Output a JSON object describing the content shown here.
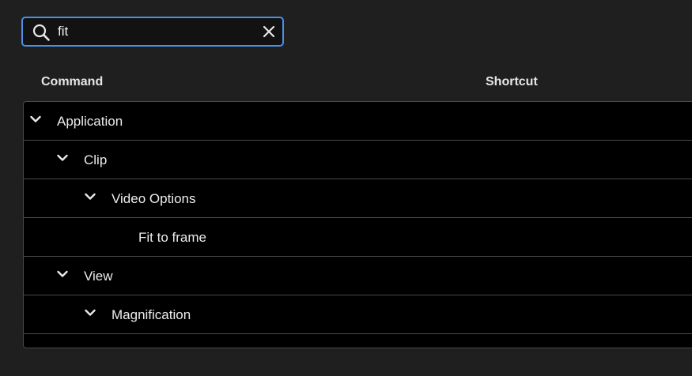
{
  "search": {
    "value": "fit",
    "icon": "search-icon",
    "clear_icon": "close-icon"
  },
  "columns": {
    "command": "Command",
    "shortcut": "Shortcut"
  },
  "tree": [
    {
      "label": "Application",
      "level": 0,
      "expandable": true,
      "expanded": true
    },
    {
      "label": "Clip",
      "level": 1,
      "expandable": true,
      "expanded": true
    },
    {
      "label": "Video Options",
      "level": 2,
      "expandable": true,
      "expanded": true
    },
    {
      "label": "Fit to frame",
      "level": 3,
      "expandable": false,
      "expanded": false
    },
    {
      "label": "View",
      "level": 1,
      "expandable": true,
      "expanded": true
    },
    {
      "label": "Magnification",
      "level": 2,
      "expandable": true,
      "expanded": true
    }
  ],
  "colors": {
    "background": "#1f1f1f",
    "panel": "#000000",
    "focus_border": "#4b8fe6",
    "divider": "#4a4a4a"
  }
}
